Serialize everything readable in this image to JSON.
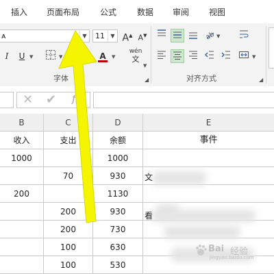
{
  "ribbon_tabs": [
    "插入",
    "页面布局",
    "公式",
    "数据",
    "审阅",
    "视图"
  ],
  "font": {
    "name_partial": "ᴀ",
    "size": "11",
    "underline_label": "U",
    "wen_label": "wén",
    "wen_sub": "文",
    "font_color_label": "A",
    "group_label": "字体",
    "colors": {
      "font_color_bar": "#c00000",
      "fill_bar": "#ffff00"
    }
  },
  "alignment": {
    "group_label": "对齐方式"
  },
  "columns": [
    "B",
    "C",
    "D",
    "E"
  ],
  "rows": [
    {
      "b": "收入",
      "c": "支出",
      "d": "余额",
      "e": "事件"
    },
    {
      "b": "1000",
      "c": "",
      "d": "1000",
      "e": ""
    },
    {
      "b": "",
      "c": "70",
      "d": "930",
      "e": ""
    },
    {
      "b": "200",
      "c": "",
      "d": "1130",
      "e": ""
    },
    {
      "b": "",
      "c": "200",
      "d": "930",
      "e": ""
    },
    {
      "b": "",
      "c": "200",
      "d": "730",
      "e": ""
    },
    {
      "b": "",
      "c": "100",
      "d": "630",
      "e": ""
    },
    {
      "b": "",
      "c": "100",
      "d": "530",
      "e": ""
    }
  ],
  "e_column_peek": [
    "文",
    "看"
  ],
  "watermark": {
    "text": "Bai",
    "sub": "经验",
    "url": "jingyan.baidu.com"
  },
  "annotation_color": "#f5f500"
}
